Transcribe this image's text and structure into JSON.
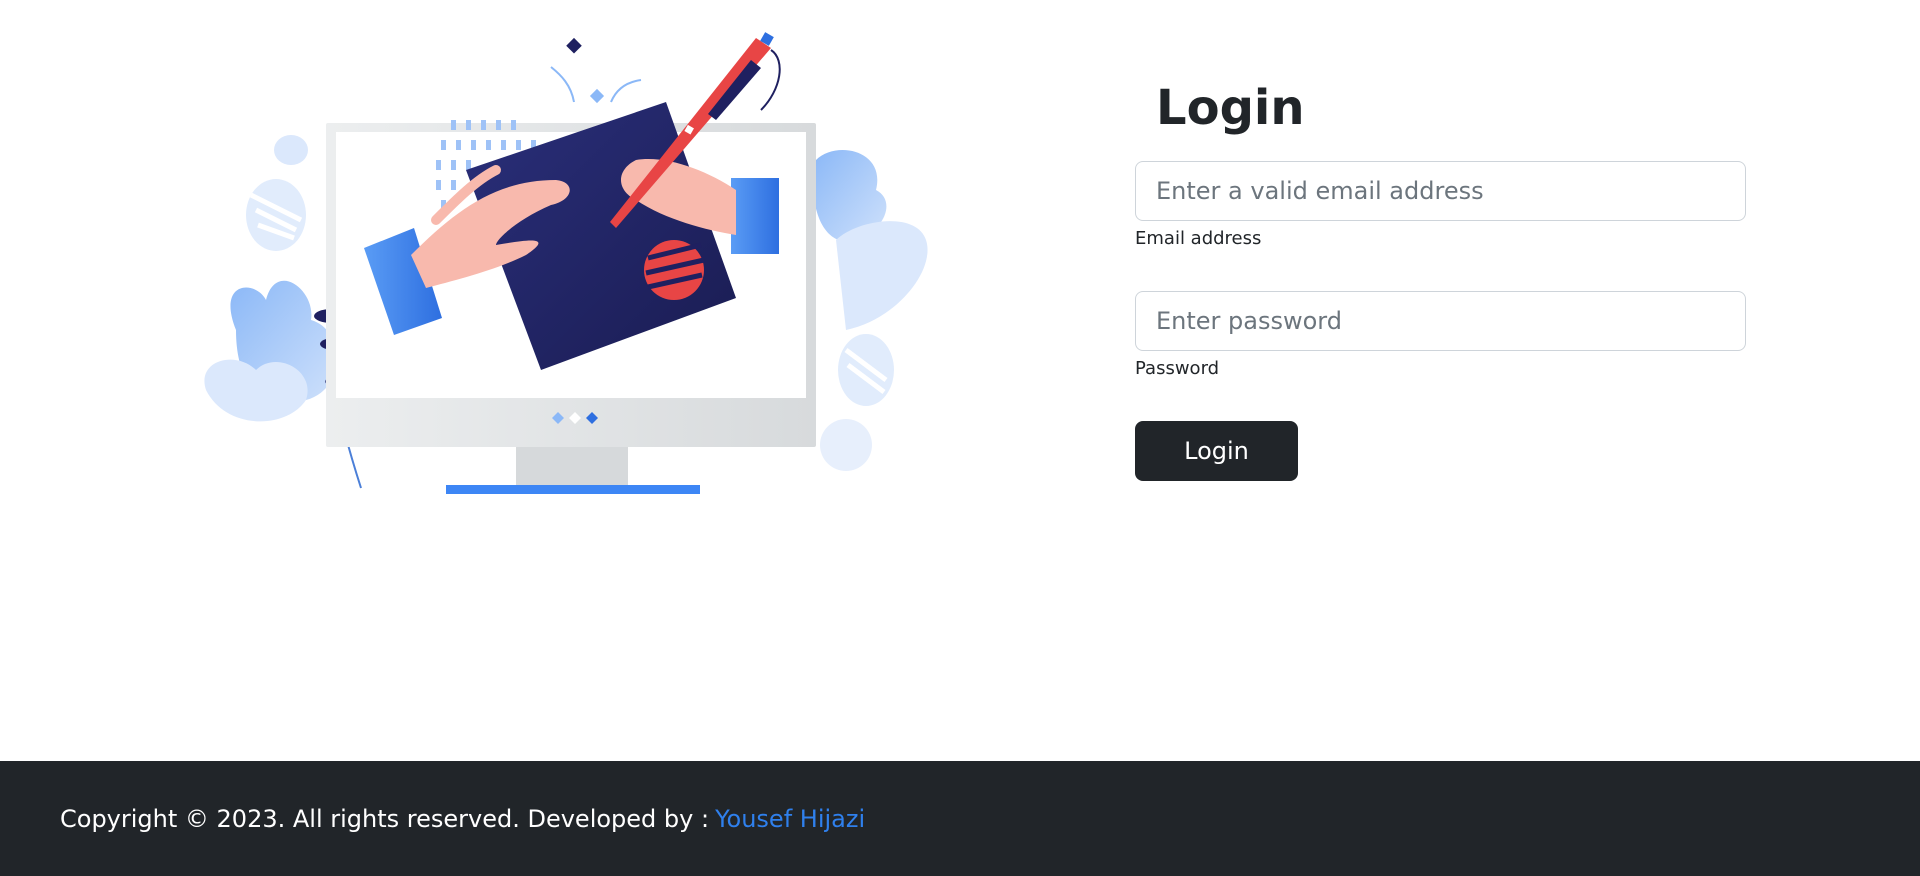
{
  "login": {
    "title": "Login",
    "email_placeholder": "Enter a valid email address",
    "email_label": "Email address",
    "password_placeholder": "Enter password",
    "password_label": "Password",
    "submit_label": "Login"
  },
  "footer": {
    "copyright_text": "Copyright © 2023. All rights reserved. Developed by :",
    "developer_link": "Yousef Hijazi"
  },
  "colors": {
    "dark": "#212529",
    "link": "#2f80ed",
    "accent_blue": "#2f80ed",
    "accent_red": "#e84545",
    "navy": "#1f2060"
  },
  "illustration": {
    "icon": "monitor-drawing-illustration"
  }
}
